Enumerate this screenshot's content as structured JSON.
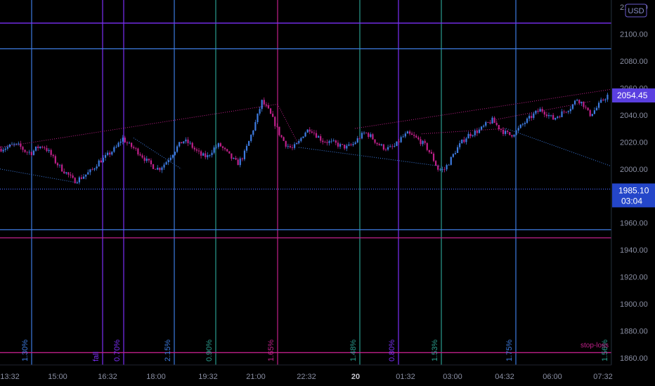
{
  "chart_data": {
    "type": "candlestick",
    "currency": "USD",
    "x_tick_labels": [
      "13:32",
      "15:00",
      "16:32",
      "18:00",
      "19:32",
      "21:00",
      "22:32",
      "20",
      "01:32",
      "03:00",
      "04:32",
      "06:00",
      "07:32"
    ],
    "y_ticks": [
      "2120.00",
      "2100.00",
      "2080.00",
      "2060.00",
      "2040.00",
      "2020.00",
      "2000.00",
      "1980.00",
      "1960.00",
      "1940.00",
      "1920.00",
      "1900.00",
      "1880.00",
      "1860.00"
    ],
    "ylim": [
      1858,
      2122
    ],
    "last_price": "2054.45",
    "last_price_value": 2054.45,
    "crosshair_price": "1985.10",
    "crosshair_price_value": 1985.1,
    "crosshair_time": "03:04",
    "horizontal_levels": [
      {
        "value": 2108,
        "color": "#7b2ff7"
      },
      {
        "value": 2089,
        "color": "#3d7be0"
      },
      {
        "value": 1985.1,
        "color": "#3d5be0",
        "style": "dotted"
      },
      {
        "value": 1955,
        "color": "#3d7be0"
      },
      {
        "value": 1949,
        "color": "#c0208a"
      },
      {
        "value": 1864,
        "color": "#c0208a"
      }
    ],
    "vertical_markers": [
      {
        "label": "1.30%",
        "color": "#3d7be0"
      },
      {
        "label": "fall",
        "color": "#7b2ff7"
      },
      {
        "label": "0.70%",
        "color": "#7b2ff7"
      },
      {
        "label": "2.15%",
        "color": "#3d7be0"
      },
      {
        "label": "0.90%",
        "color": "#2a9d8f"
      },
      {
        "label": "1.65%",
        "color": "#c0208a"
      },
      {
        "label": "1.48%",
        "color": "#2a9d8f"
      },
      {
        "label": "0.80%",
        "color": "#7b2ff7"
      },
      {
        "label": "1.53%",
        "color": "#2a9d8f"
      },
      {
        "label": "1.75%",
        "color": "#3d7be0"
      },
      {
        "label": "1.56%",
        "color": "#2a9d8f"
      }
    ],
    "annotations": [
      "stop-loss"
    ],
    "price_path": [
      2015,
      2016,
      2018,
      2017,
      2013,
      2012,
      2016,
      2017,
      2012,
      2005,
      2000,
      1996,
      1991,
      1993,
      1996,
      1999,
      2005,
      2008,
      2012,
      2016,
      2023,
      2018,
      2015,
      2011,
      2006,
      2002,
      2000,
      2004,
      2010,
      2016,
      2021,
      2019,
      2014,
      2010,
      2009,
      2015,
      2018,
      2013,
      2008,
      2004,
      2010,
      2022,
      2035,
      2050,
      2044,
      2035,
      2025,
      2018,
      2015,
      2019,
      2027,
      2030,
      2025,
      2021,
      2020,
      2019,
      2017,
      2016,
      2018,
      2023,
      2027,
      2024,
      2019,
      2016,
      2015,
      2017,
      2023,
      2026,
      2024,
      2021,
      2017,
      2010,
      2000,
      1999,
      2006,
      2014,
      2020,
      2025,
      2027,
      2029,
      2033,
      2036,
      2031,
      2027,
      2025,
      2028,
      2033,
      2037,
      2041,
      2044,
      2041,
      2037,
      2040,
      2043,
      2046,
      2052,
      2048,
      2040,
      2044,
      2050,
      2054.45
    ],
    "colors": {
      "up": "#3d7be0",
      "down": "#c0208a",
      "axis_text": "#8a8fa3",
      "grid_line": "#1a1d2b"
    }
  }
}
